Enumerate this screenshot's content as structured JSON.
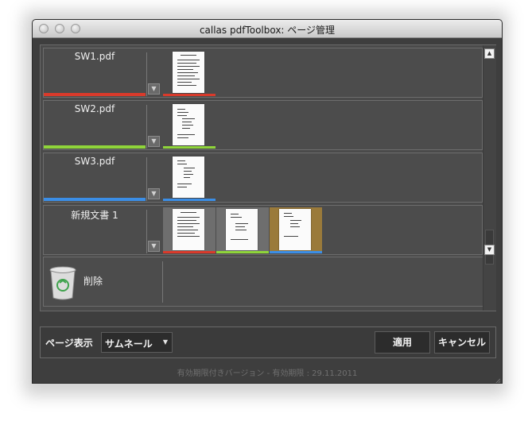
{
  "window": {
    "title": "callas pdfToolbox: ページ管理"
  },
  "documents": [
    {
      "name": "SW1.pdf",
      "color": "#d93a2b",
      "page_count": 1
    },
    {
      "name": "SW2.pdf",
      "color": "#8fd53a",
      "page_count": 1
    },
    {
      "name": "SW3.pdf",
      "color": "#3b8ee6",
      "page_count": 1
    },
    {
      "name": "新規文書 1",
      "color": "",
      "page_count": 3
    }
  ],
  "new_document_pages": [
    {
      "source_color": "#d93a2b",
      "background": "#7a7a7a"
    },
    {
      "source_color": "#8fd53a",
      "background": "#7a7a7a"
    },
    {
      "source_color": "#3b8ee6",
      "background": "#9a7a3a"
    }
  ],
  "trash": {
    "label": "削除",
    "icon": "trash-icon"
  },
  "controls": {
    "view_label": "ページ表示",
    "view_value": "サムネール",
    "apply_label": "適用",
    "cancel_label": "キャンセル"
  },
  "footer": {
    "note": "有効期限付きバージョン - 有効期限 : 29.11.2011"
  },
  "scrollbar": {
    "up_icon": "arrow-up-icon",
    "down_icon": "arrow-down-icon"
  }
}
